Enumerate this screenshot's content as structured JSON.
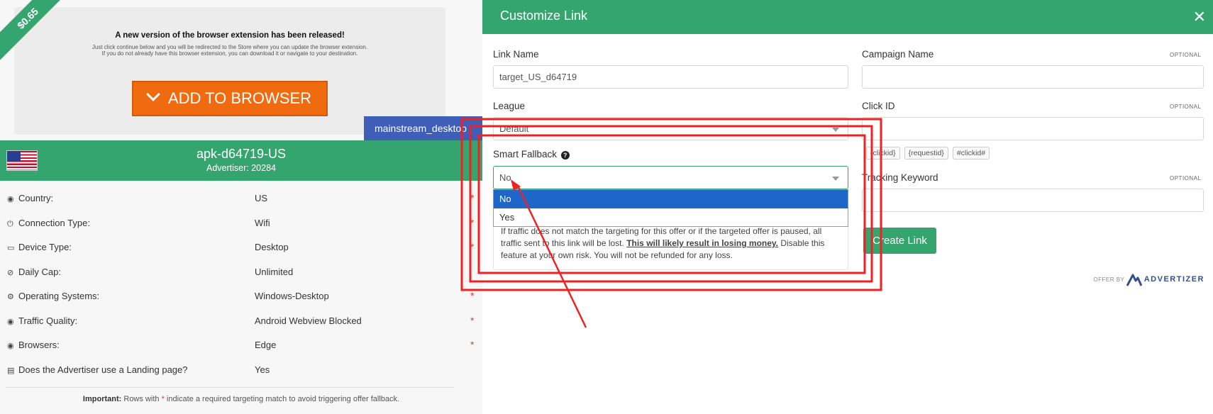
{
  "preview": {
    "price_ribbon": "$0.65",
    "headline": "A new version of the browser extension has been released!",
    "line1": "Just click continue below and you will be redirected to the Store where you can update the browser extension.",
    "line2": "If you do not already have this browser extension, you can download it or navigate to your destination.",
    "button": "ADD TO BROWSER",
    "tag": "mainstream_desktop"
  },
  "offer": {
    "name": "apk-d64719-US",
    "advertiser": "Advertiser: 20284",
    "rows": [
      {
        "icon": "globe-icon",
        "glyph": "◉",
        "label": "Country:",
        "value": "US",
        "required": "*"
      },
      {
        "icon": "power-icon",
        "glyph": "⏻",
        "label": "Connection Type:",
        "value": "Wifi",
        "required": "*"
      },
      {
        "icon": "monitor-icon",
        "glyph": "▭",
        "label": "Device Type:",
        "value": "Desktop",
        "required": "*"
      },
      {
        "icon": "ban-icon",
        "glyph": "⊘",
        "label": "Daily Cap:",
        "value": "Unlimited",
        "required": ""
      },
      {
        "icon": "gear-icon",
        "glyph": "⚙",
        "label": "Operating Systems:",
        "value": "Windows-Desktop",
        "required": "*"
      },
      {
        "icon": "globe-icon",
        "glyph": "◉",
        "label": "Traffic Quality:",
        "value": "Android Webview Blocked",
        "required": "*"
      },
      {
        "icon": "globe-icon",
        "glyph": "◉",
        "label": "Browsers:",
        "value": "Edge",
        "required": "*"
      },
      {
        "icon": "file-icon",
        "glyph": "▤",
        "label": "Does the Advertiser use a Landing page?",
        "value": "Yes",
        "required": ""
      }
    ],
    "note_bold": "Important:",
    "note_pre": " Rows with ",
    "note_star": "*",
    "note_post": " indicate a required targeting match to avoid triggering offer fallback."
  },
  "modal": {
    "title": "Customize Link",
    "close": "✕",
    "link_name_label": "Link Name",
    "link_name_value": "target_US_d64719",
    "campaign_label": "Campaign Name",
    "optional": "OPTIONAL",
    "league_label": "League",
    "league_value": "Default",
    "click_id_label": "Click ID",
    "chips": [
      "{clickid}",
      "{requestid}",
      "#clickid#"
    ],
    "smart_fallback_label": "Smart Fallback",
    "smart_fallback_value": "No",
    "dropdown_options": [
      "No",
      "Yes"
    ],
    "tracking_label": "Tracking Keyword",
    "warning_pre": "If traffic does not match the targeting for this offer or if the targeted offer is paused, all traffic sent to this link will be lost. ",
    "warning_strong": "This will likely result in losing money.",
    "warning_post": " Disable this feature at your own risk. You will not be refunded for any loss.",
    "create_button": "Create Link",
    "offer_by": "OFFER BY",
    "brand": "ADVERTIZER"
  },
  "colors": {
    "green": "#35a56f",
    "orange": "#f06b10",
    "blue_tag": "#3f5eb8",
    "highlight": "#1e66c8",
    "annotation": "#ee2222"
  }
}
